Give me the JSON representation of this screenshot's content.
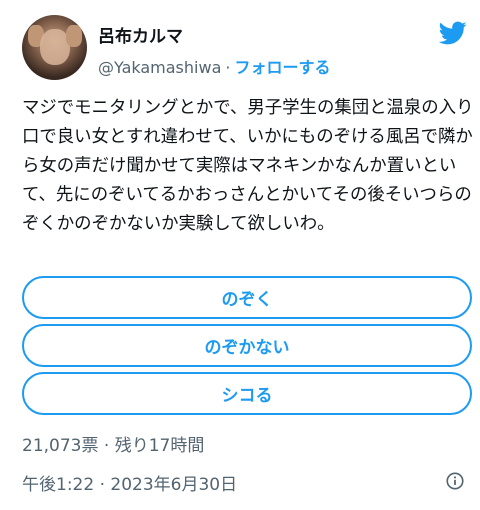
{
  "author": {
    "display_name": "呂布カルマ",
    "handle": "@Yakamashiwa",
    "separator": "·",
    "follow_label": "フォローする"
  },
  "icons": {
    "brand": "twitter-bird-icon",
    "info": "info-icon",
    "brand_color": "#1d9bf0"
  },
  "tweet": {
    "text": "マジでモニタリングとかで、男子学生の集団と温泉の入り口で良い女とすれ違わせて、いかにものぞける風呂で隣から女の声だけ聞かせて実際はマネキンかなんか置いといて、先にのぞいてるかおっさんとかいてその後そいつらのぞくかのぞかないか実験して欲しいわ。"
  },
  "poll": {
    "options": [
      {
        "label": "のぞく"
      },
      {
        "label": "のぞかない"
      },
      {
        "label": "シコる"
      }
    ],
    "meta": "21,073票 · 残り17時間"
  },
  "timestamp": "午後1:22 · 2023年6月30日"
}
